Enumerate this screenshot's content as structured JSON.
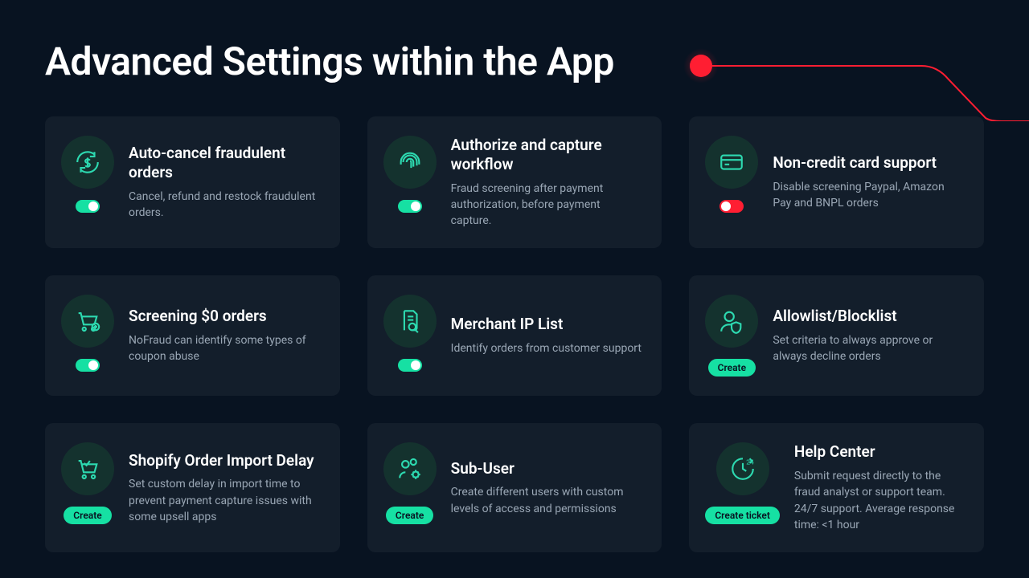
{
  "page": {
    "title": "Advanced Settings within the App"
  },
  "cards": [
    {
      "icon": "refresh-dollar",
      "title": "Auto-cancel fraudulent orders",
      "desc": "Cancel, refund and restock fraudulent orders.",
      "control": "toggle",
      "state": "on"
    },
    {
      "icon": "fingerprint",
      "title": "Authorize and capture workflow",
      "desc": "Fraud screening after payment authorization, before payment capture.",
      "control": "toggle",
      "state": "on"
    },
    {
      "icon": "credit-card",
      "title": "Non-credit card support",
      "desc": "Disable screening Paypal, Amazon Pay and BNPL orders",
      "control": "toggle",
      "state": "off"
    },
    {
      "icon": "cart-plus",
      "title": "Screening $0 orders",
      "desc": "NoFraud can identify some types of coupon abuse",
      "control": "toggle",
      "state": "on"
    },
    {
      "icon": "document-search",
      "title": "Merchant IP List",
      "desc": "Identify orders from customer support",
      "control": "toggle",
      "state": "on"
    },
    {
      "icon": "user-shield",
      "title": "Allowlist/Blocklist",
      "desc": "Set criteria to always approve or always decline orders",
      "control": "button",
      "button_label": "Create"
    },
    {
      "icon": "cart-check",
      "title": "Shopify Order Import Delay",
      "desc": "Set custom delay in import time to prevent payment capture issues with some upsell apps",
      "control": "button",
      "button_label": "Create"
    },
    {
      "icon": "users-gear",
      "title": "Sub-User",
      "desc": "Create different users with custom levels of access and permissions",
      "control": "button",
      "button_label": "Create"
    },
    {
      "icon": "clock-24",
      "title": "Help Center",
      "desc": "Submit request directly to the fraud analyst or support team. 24/7 support. Average response time: <1 hour",
      "control": "button",
      "button_label": "Create ticket"
    }
  ]
}
